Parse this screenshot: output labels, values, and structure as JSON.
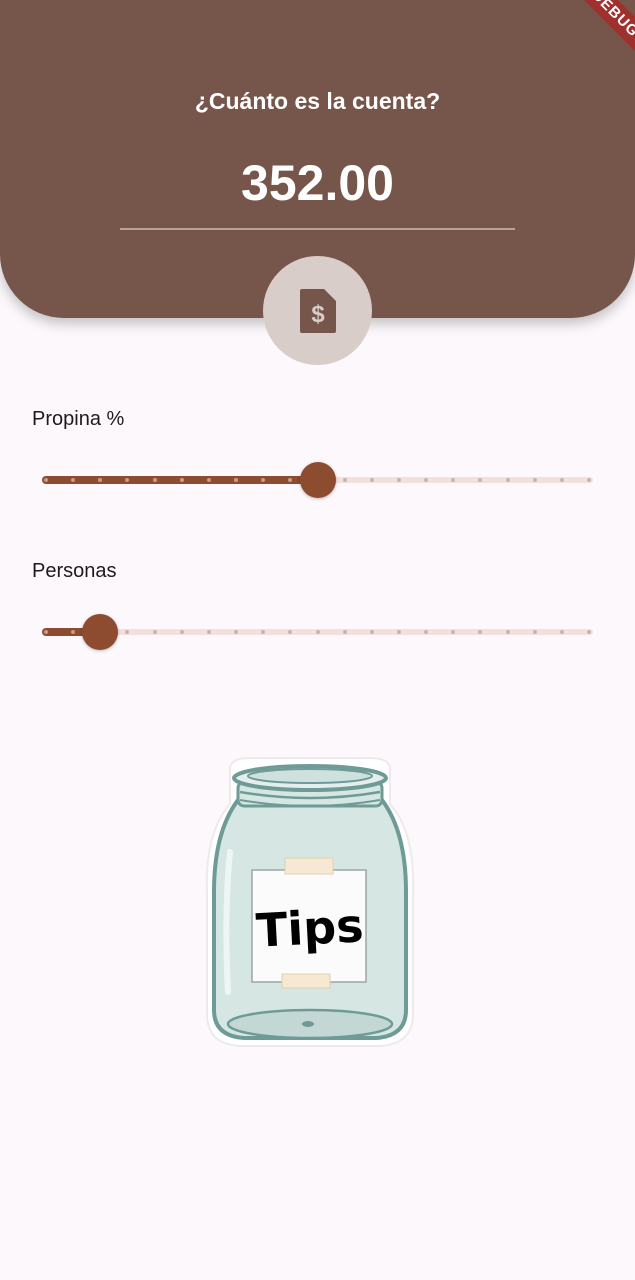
{
  "header": {
    "question": "¿Cuánto es la cuenta?",
    "amount": "352.00",
    "background_color": "#76554a",
    "receipt_button_icon": "receipt-dollar-icon"
  },
  "debug_banner": {
    "label": "DEBUG"
  },
  "tip_slider": {
    "label": "Propina %",
    "value": 50,
    "min": 0,
    "max": 100,
    "divisions": 20
  },
  "people_slider": {
    "label": "Personas",
    "value": 3,
    "min": 1,
    "max": 21,
    "divisions": 20
  },
  "jar_image": {
    "label": "Tips",
    "icon": "tip-jar-illustration"
  },
  "colors": {
    "accent": "#8d4b30",
    "track_inactive": "#f3e0dd",
    "page_background": "#fcf8fb",
    "receipt_circle": "#d9cdca"
  }
}
